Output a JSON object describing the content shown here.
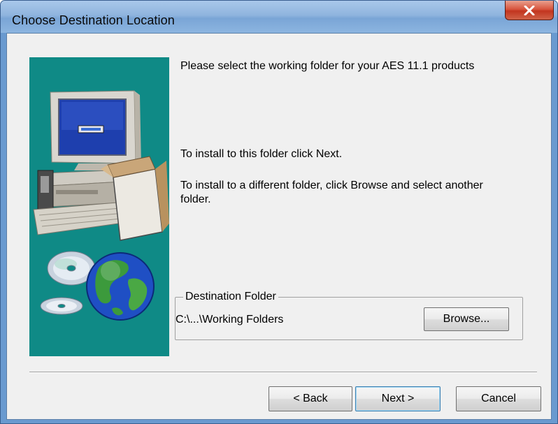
{
  "window": {
    "title": "Choose Destination Location",
    "close_icon": "close-x-icon"
  },
  "content": {
    "intro": "Please select the working folder for your AES 11.1 products",
    "install_next": "To install to this folder click Next.",
    "install_browse_line1": "To install to a different folder, click Browse and select another",
    "install_browse_line2": "folder."
  },
  "destination": {
    "group_label": "Destination Folder",
    "path": "C:\\...\\Working Folders",
    "browse_label": "Browse..."
  },
  "buttons": {
    "back_label": "< Back",
    "next_label": "Next >",
    "cancel_label": "Cancel"
  },
  "colors": {
    "panel_teal": "#0f8a86",
    "title_bar": "#8fb4de",
    "close_red": "#c2351f"
  },
  "icons": [
    "computer-icon",
    "cd-disc-icon",
    "globe-icon"
  ]
}
